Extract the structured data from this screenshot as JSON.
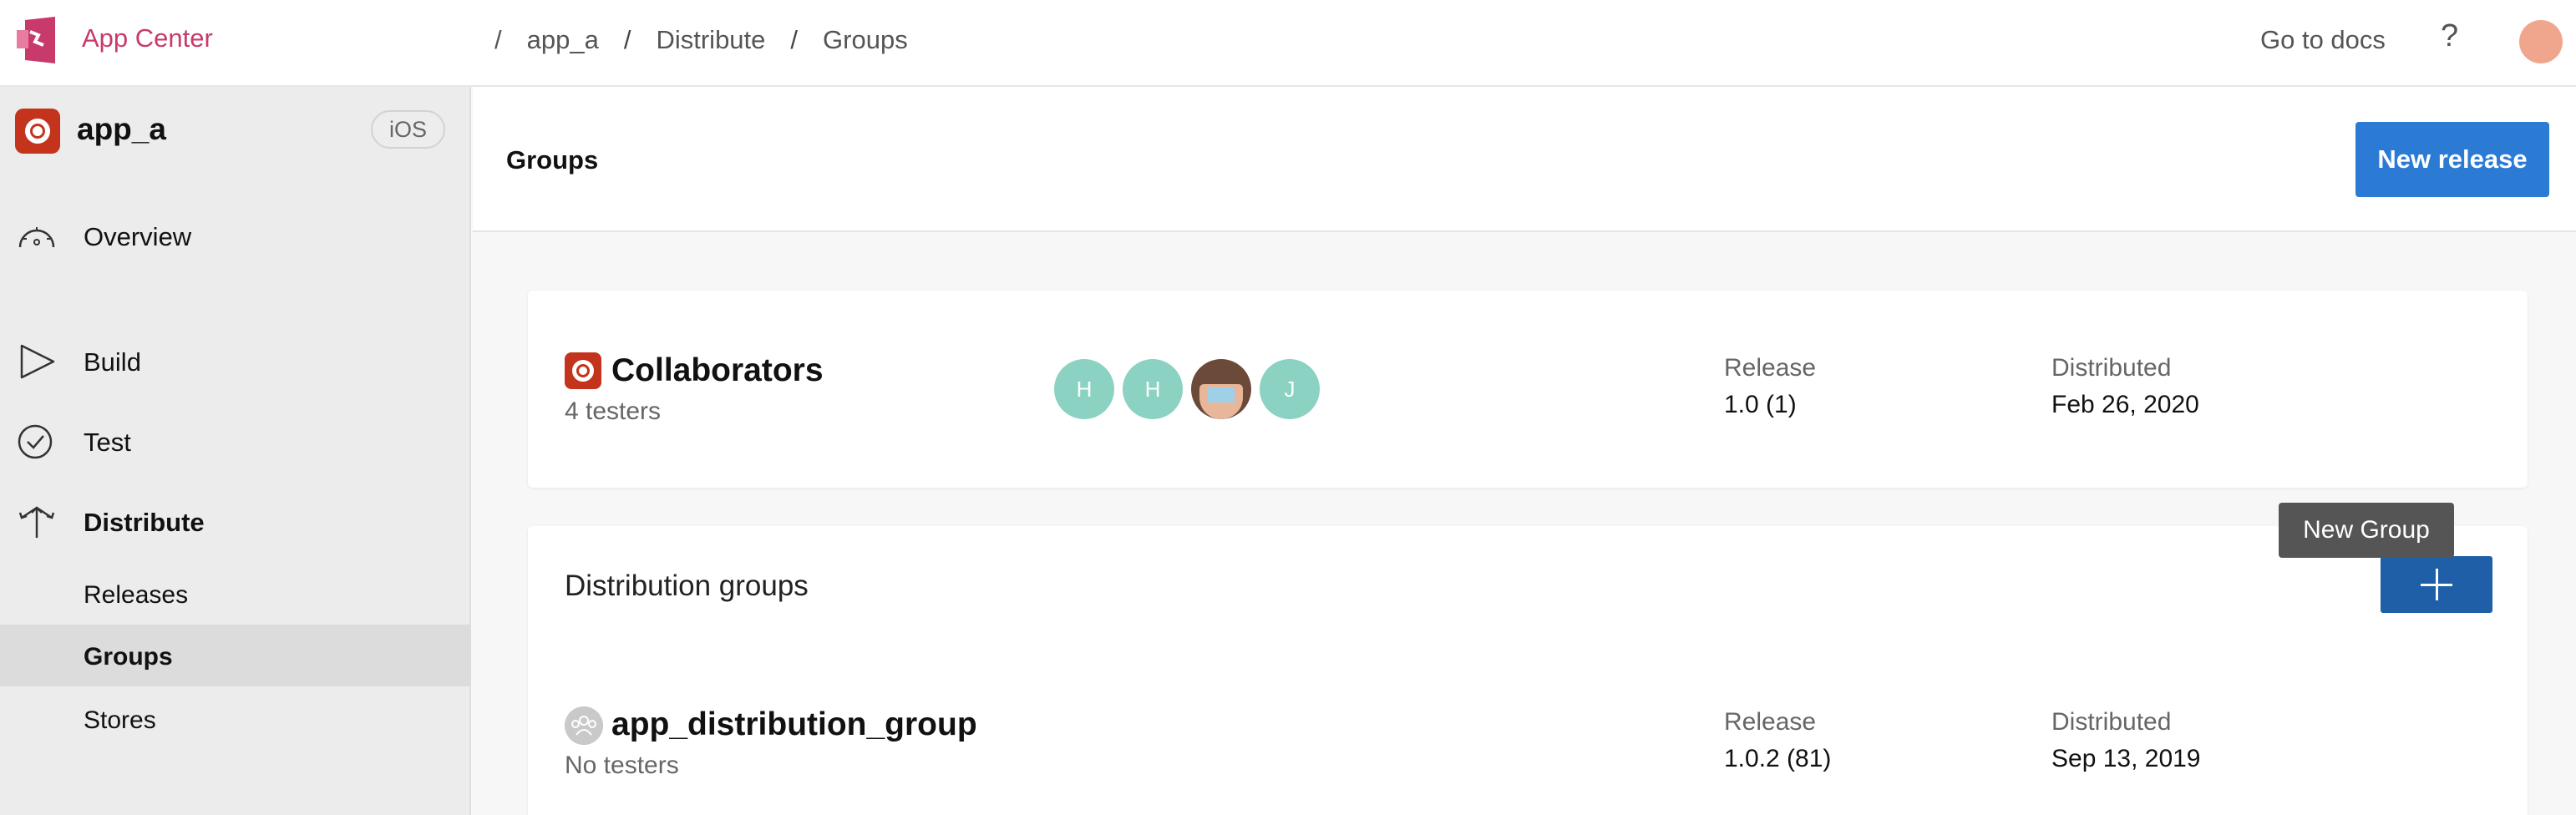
{
  "topbar": {
    "brand": "App Center",
    "breadcrumb": [
      "app_a",
      "Distribute",
      "Groups"
    ],
    "separator": "/",
    "docs_link": "Go to docs",
    "help": "?"
  },
  "sidebar": {
    "app_name": "app_a",
    "platform": "iOS",
    "nav": [
      {
        "label": "Overview",
        "icon": "gauge-icon"
      },
      {
        "label": "Build",
        "icon": "play-icon"
      },
      {
        "label": "Test",
        "icon": "check-circle-icon"
      },
      {
        "label": "Distribute",
        "icon": "distribute-arrows-icon"
      }
    ],
    "distribute_sub": [
      "Releases",
      "Groups",
      "Stores"
    ],
    "active_sub": "Groups"
  },
  "header": {
    "title": "Groups",
    "new_release": "New release"
  },
  "collaborators": {
    "name": "Collaborators",
    "testers": "4 testers",
    "avatars": [
      "H",
      "H",
      "",
      "J"
    ],
    "release_label": "Release",
    "release_value": "1.0 (1)",
    "distributed_label": "Distributed",
    "distributed_value": "Feb 26, 2020"
  },
  "distribution_groups": {
    "title": "Distribution groups",
    "tooltip": "New Group",
    "groups": [
      {
        "name": "app_distribution_group",
        "testers": "No testers",
        "release_label": "Release",
        "release_value": "1.0.2 (81)",
        "distributed_label": "Distributed",
        "distributed_value": "Sep 13, 2019"
      }
    ]
  },
  "colors": {
    "brand": "#c83a6c",
    "primary": "#2b7bd4",
    "add_button": "#1f5fa8",
    "tester_avatar": "#8bd2c3",
    "user_avatar": "#f0a58d"
  }
}
